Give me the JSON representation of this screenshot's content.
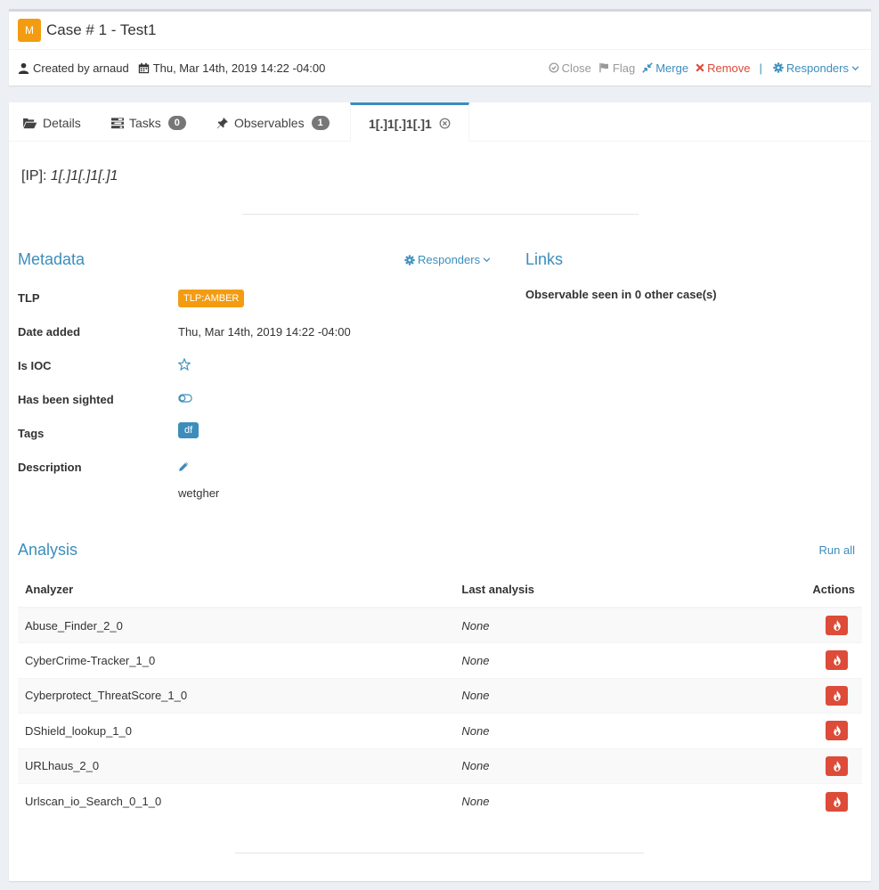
{
  "case": {
    "severity_label": "M",
    "title": "Case # 1 - Test1",
    "created_by": "Created by arnaud",
    "date": "Thu, Mar 14th, 2019 14:22 -04:00",
    "actions": {
      "close": "Close",
      "flag": "Flag",
      "merge": "Merge",
      "remove": "Remove",
      "separator": "|",
      "responders": "Responders"
    }
  },
  "tabs": {
    "details": "Details",
    "tasks": "Tasks",
    "tasks_count": "0",
    "observables": "Observables",
    "observables_count": "1",
    "active": "1[.]1[.]1[.]1"
  },
  "observable": {
    "type_label": "[IP]:",
    "value": "1[.]1[.]1[.]1"
  },
  "metadata": {
    "heading": "Metadata",
    "responders": "Responders",
    "tlp_label": "TLP",
    "tlp_value": "TLP:AMBER",
    "date_label": "Date added",
    "date_value": "Thu, Mar 14th, 2019 14:22 -04:00",
    "ioc_label": "Is IOC",
    "sighted_label": "Has been sighted",
    "tags_label": "Tags",
    "tag": "df",
    "desc_label": "Description",
    "desc_value": "wetgher"
  },
  "links": {
    "heading": "Links",
    "text": "Observable seen in 0 other case(s)"
  },
  "analysis": {
    "heading": "Analysis",
    "run_all": "Run all",
    "columns": [
      "Analyzer",
      "Last analysis",
      "Actions"
    ],
    "rows": [
      {
        "analyzer": "Abuse_Finder_2_0",
        "last": "None"
      },
      {
        "analyzer": "CyberCrime-Tracker_1_0",
        "last": "None"
      },
      {
        "analyzer": "Cyberprotect_ThreatScore_1_0",
        "last": "None"
      },
      {
        "analyzer": "DShield_lookup_1_0",
        "last": "None"
      },
      {
        "analyzer": "URLhaus_2_0",
        "last": "None"
      },
      {
        "analyzer": "Urlscan_io_Search_0_1_0",
        "last": "None"
      }
    ]
  },
  "colors": {
    "accent": "#3c8dbc",
    "amber": "#f39c12",
    "danger": "#dd4b39"
  }
}
